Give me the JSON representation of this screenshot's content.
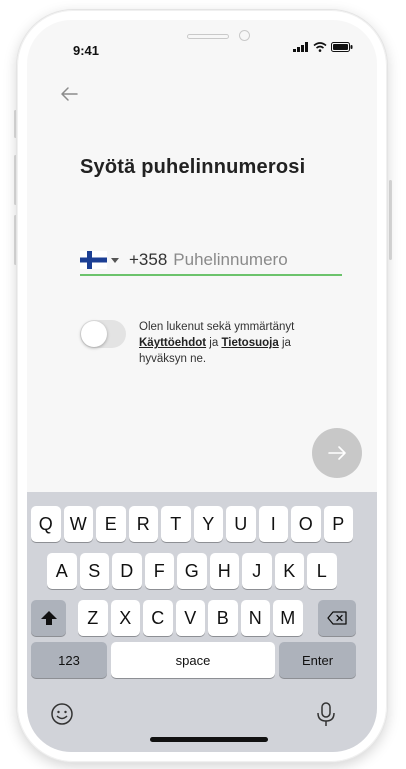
{
  "status_bar": {
    "time": "9:41"
  },
  "page": {
    "title": "Syötä puhelinnumerosi"
  },
  "phone": {
    "country_flag": "finland-flag-icon",
    "dial_code": "+358",
    "placeholder": "Puhelinnumero",
    "value": ""
  },
  "consent": {
    "toggle_on": false,
    "text_before": "Olen lukenut sekä ymmärtänyt ",
    "terms_link": "Käyttöehdot",
    "and": " ja ",
    "privacy_link": "Tietosuoja",
    "text_after": " ja hyväksyn ne."
  },
  "keyboard": {
    "row1": [
      "Q",
      "W",
      "E",
      "R",
      "T",
      "Y",
      "U",
      "I",
      "O",
      "P"
    ],
    "row2": [
      "A",
      "S",
      "D",
      "F",
      "G",
      "H",
      "J",
      "K",
      "L"
    ],
    "row3": [
      "Z",
      "X",
      "C",
      "V",
      "B",
      "N",
      "M"
    ],
    "numbers_label": "123",
    "space_label": "space",
    "enter_label": "Enter"
  },
  "colors": {
    "accent": "#6cc36c",
    "flag_blue": "#1c3f94",
    "next_button": "#c8c8c8"
  }
}
